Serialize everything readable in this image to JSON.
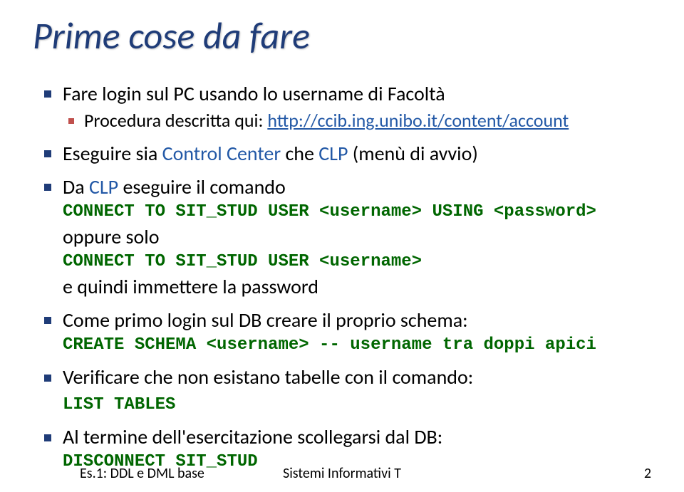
{
  "title": "Prime cose da fare",
  "bullets": {
    "b1_text": "Fare login sul PC usando lo username di Facoltà",
    "b1_sub_text": "Procedura descritta qui: ",
    "b1_link": "http://ccib.ing.unibo.it/content/account",
    "b2_prefix": "Eseguire sia ",
    "b2_cc": "Control Center ",
    "b2_mid": "che ",
    "b2_clp": "CLP ",
    "b2_suffix": "(menù di avvio)",
    "b3_prefix": "Da ",
    "b3_clp": "CLP ",
    "b3_rest": "eseguire il comando",
    "b3_code1": "CONNECT TO SIT_STUD USER <username> USING <password>",
    "b3_oppure": "oppure solo",
    "b3_code2": "CONNECT TO SIT_STUD USER <username>",
    "b3_tail": "e quindi immettere la password",
    "b4_text": "Come primo login sul DB creare il proprio schema:",
    "b4_code": "CREATE SCHEMA <username> -- username tra doppi apici",
    "b5_text": "Verificare che non esistano tabelle con il comando:",
    "b5_code": "LIST TABLES",
    "b6_text": "Al termine dell'esercitazione scollegarsi dal DB:",
    "b6_code": "DISCONNECT SIT_STUD"
  },
  "footer": {
    "left": "Es.1: DDL e DML base",
    "center": "Sistemi Informativi T",
    "right": "2"
  }
}
